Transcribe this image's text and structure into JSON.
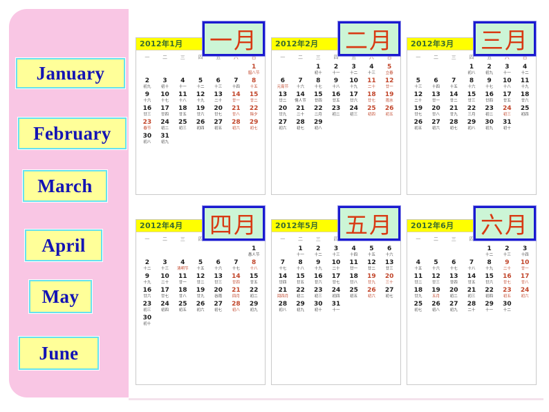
{
  "background": {
    "page_color": "#ffffff",
    "panel_color": "#f9c6e4",
    "star_glyph": "★",
    "star_glyph_2": "★"
  },
  "palette": {
    "chip_yellow": "#ffff99",
    "chip_cyan_border": "#66e2ee",
    "chip_blue_text": "#1414b4",
    "cn_chip_green": "#ccf5d6",
    "cn_chip_blue_border": "#1a1ad0",
    "cn_chip_red_text": "#d83a13",
    "cal_header_yellow": "#ffff00",
    "cal_header_text": "#3a6b2f",
    "holiday_red": "#c1452a"
  },
  "english_labels": [
    {
      "name": "january",
      "text": "January"
    },
    {
      "name": "february",
      "text": "February"
    },
    {
      "name": "march",
      "text": "March"
    },
    {
      "name": "april",
      "text": "April"
    },
    {
      "name": "may",
      "text": "May"
    },
    {
      "name": "june",
      "text": "June"
    }
  ],
  "chinese_labels": [
    {
      "name": "yi-yue",
      "text": "一月"
    },
    {
      "name": "er-yue",
      "text": "二月"
    },
    {
      "name": "san-yue",
      "text": "三月"
    },
    {
      "name": "si-yue",
      "text": "四月"
    },
    {
      "name": "wu-yue",
      "text": "五月"
    },
    {
      "name": "liu-yue",
      "text": "六月"
    }
  ],
  "weekday_headers": [
    "一",
    "二",
    "三",
    "四",
    "五",
    "六",
    "日"
  ],
  "calendars": [
    {
      "id": "jan",
      "title": "2012年1月",
      "weeks": [
        [
          null,
          null,
          null,
          null,
          null,
          null,
          {
            "n": "1",
            "s": "腊八节",
            "r": true,
            "f": true
          }
        ],
        [
          {
            "n": "2",
            "s": "初九"
          },
          {
            "n": "3",
            "s": "初十"
          },
          {
            "n": "4",
            "s": "十一"
          },
          {
            "n": "5",
            "s": "十二"
          },
          {
            "n": "6",
            "s": "十三"
          },
          {
            "n": "7",
            "s": "十四"
          },
          {
            "n": "8",
            "s": "十五",
            "r": true
          }
        ],
        [
          {
            "n": "9",
            "s": "十六"
          },
          {
            "n": "10",
            "s": "十七"
          },
          {
            "n": "11",
            "s": "十八"
          },
          {
            "n": "12",
            "s": "十九"
          },
          {
            "n": "13",
            "s": "二十"
          },
          {
            "n": "14",
            "s": "廿一",
            "r": true
          },
          {
            "n": "15",
            "s": "廿二",
            "r": true
          }
        ],
        [
          {
            "n": "16",
            "s": "廿三"
          },
          {
            "n": "17",
            "s": "廿四"
          },
          {
            "n": "18",
            "s": "廿五"
          },
          {
            "n": "19",
            "s": "廿六"
          },
          {
            "n": "20",
            "s": "廿七"
          },
          {
            "n": "21",
            "s": "廿八",
            "r": true
          },
          {
            "n": "22",
            "s": "除夕",
            "r": true
          }
        ],
        [
          {
            "n": "23",
            "s": "春节",
            "r": true,
            "f": true
          },
          {
            "n": "24",
            "s": "初二"
          },
          {
            "n": "25",
            "s": "初三"
          },
          {
            "n": "26",
            "s": "初四"
          },
          {
            "n": "27",
            "s": "初五"
          },
          {
            "n": "28",
            "s": "初六",
            "r": true
          },
          {
            "n": "29",
            "s": "初七",
            "r": true
          }
        ],
        [
          {
            "n": "30",
            "s": "初八"
          },
          {
            "n": "31",
            "s": "初九"
          },
          null,
          null,
          null,
          null,
          null
        ]
      ]
    },
    {
      "id": "feb",
      "title": "2012年2月",
      "weeks": [
        [
          null,
          null,
          {
            "n": "1",
            "s": "初十"
          },
          {
            "n": "2",
            "s": "十一"
          },
          {
            "n": "3",
            "s": "十二"
          },
          {
            "n": "4",
            "s": "十三"
          },
          {
            "n": "5",
            "s": "立春",
            "r": true
          }
        ],
        [
          {
            "n": "6",
            "s": "元宵节",
            "f": true
          },
          {
            "n": "7",
            "s": "十六"
          },
          {
            "n": "8",
            "s": "十七"
          },
          {
            "n": "9",
            "s": "十八"
          },
          {
            "n": "10",
            "s": "十九"
          },
          {
            "n": "11",
            "s": "二十",
            "r": true
          },
          {
            "n": "12",
            "s": "廿一",
            "r": true
          }
        ],
        [
          {
            "n": "13",
            "s": "廿二"
          },
          {
            "n": "14",
            "s": "情人节"
          },
          {
            "n": "15",
            "s": "廿四"
          },
          {
            "n": "16",
            "s": "廿五"
          },
          {
            "n": "17",
            "s": "廿六"
          },
          {
            "n": "18",
            "s": "廿七",
            "r": true
          },
          {
            "n": "19",
            "s": "雨水",
            "r": true
          }
        ],
        [
          {
            "n": "20",
            "s": "廿九"
          },
          {
            "n": "21",
            "s": "二十"
          },
          {
            "n": "22",
            "s": "二月"
          },
          {
            "n": "23",
            "s": "初二"
          },
          {
            "n": "24",
            "s": "初三"
          },
          {
            "n": "25",
            "s": "初四",
            "r": true
          },
          {
            "n": "26",
            "s": "初五",
            "r": true
          }
        ],
        [
          {
            "n": "27",
            "s": "初六"
          },
          {
            "n": "28",
            "s": "初七"
          },
          {
            "n": "29",
            "s": "初八"
          },
          null,
          null,
          null,
          null
        ]
      ]
    },
    {
      "id": "mar",
      "title": "2012年3月",
      "weeks": [
        [
          null,
          null,
          null,
          {
            "n": "1",
            "s": "初八"
          },
          {
            "n": "2",
            "s": "初九"
          },
          {
            "n": "3",
            "s": "十一"
          },
          {
            "n": "4",
            "s": "十二"
          }
        ],
        [
          {
            "n": "5",
            "s": "十三"
          },
          {
            "n": "6",
            "s": "十四"
          },
          {
            "n": "7",
            "s": "十五"
          },
          {
            "n": "8",
            "s": "十六"
          },
          {
            "n": "9",
            "s": "十七"
          },
          {
            "n": "10",
            "s": "十八"
          },
          {
            "n": "11",
            "s": "十九"
          }
        ],
        [
          {
            "n": "12",
            "s": "二十"
          },
          {
            "n": "13",
            "s": "廿一"
          },
          {
            "n": "14",
            "s": "廿二"
          },
          {
            "n": "15",
            "s": "廿三"
          },
          {
            "n": "16",
            "s": "廿四"
          },
          {
            "n": "17",
            "s": "廿五"
          },
          {
            "n": "18",
            "s": "廿六"
          }
        ],
        [
          {
            "n": "19",
            "s": "廿七"
          },
          {
            "n": "20",
            "s": "廿八"
          },
          {
            "n": "21",
            "s": "廿九"
          },
          {
            "n": "22",
            "s": "三月"
          },
          {
            "n": "23",
            "s": "初二"
          },
          {
            "n": "24",
            "s": "初三",
            "r": true
          },
          {
            "n": "25",
            "s": "初四"
          }
        ],
        [
          {
            "n": "26",
            "s": "初五"
          },
          {
            "n": "27",
            "s": "初六"
          },
          {
            "n": "28",
            "s": "初七"
          },
          {
            "n": "29",
            "s": "初八"
          },
          {
            "n": "30",
            "s": "初九"
          },
          {
            "n": "31",
            "s": "初十"
          },
          null
        ]
      ]
    },
    {
      "id": "apr",
      "title": "2012年4月",
      "weeks": [
        [
          null,
          null,
          null,
          null,
          null,
          null,
          {
            "n": "1",
            "s": "愚人节"
          }
        ],
        [
          {
            "n": "2",
            "s": "十二"
          },
          {
            "n": "3",
            "s": "十三"
          },
          {
            "n": "4",
            "s": "清明节",
            "f": true
          },
          {
            "n": "5",
            "s": "十五"
          },
          {
            "n": "6",
            "s": "十六"
          },
          {
            "n": "7",
            "s": "十七"
          },
          {
            "n": "8",
            "s": "十八",
            "r": true
          }
        ],
        [
          {
            "n": "9",
            "s": "十九"
          },
          {
            "n": "10",
            "s": "二十"
          },
          {
            "n": "11",
            "s": "廿一"
          },
          {
            "n": "12",
            "s": "廿二"
          },
          {
            "n": "13",
            "s": "廿三"
          },
          {
            "n": "14",
            "s": "廿四",
            "r": true
          },
          {
            "n": "15",
            "s": "廿五"
          }
        ],
        [
          {
            "n": "16",
            "s": "廿六"
          },
          {
            "n": "17",
            "s": "廿七"
          },
          {
            "n": "18",
            "s": "廿八"
          },
          {
            "n": "19",
            "s": "廿九"
          },
          {
            "n": "20",
            "s": "谷雨"
          },
          {
            "n": "21",
            "s": "四月",
            "r": true
          },
          {
            "n": "22",
            "s": "初二"
          }
        ],
        [
          {
            "n": "23",
            "s": "初三"
          },
          {
            "n": "24",
            "s": "初四"
          },
          {
            "n": "25",
            "s": "初五"
          },
          {
            "n": "26",
            "s": "初六"
          },
          {
            "n": "27",
            "s": "初七"
          },
          {
            "n": "28",
            "s": "初八",
            "r": true
          },
          {
            "n": "29",
            "s": "初九"
          }
        ],
        [
          {
            "n": "30",
            "s": "初十"
          },
          null,
          null,
          null,
          null,
          null,
          null
        ]
      ]
    },
    {
      "id": "may",
      "title": "2012年5月",
      "weeks": [
        [
          null,
          {
            "n": "1",
            "s": "十一"
          },
          {
            "n": "2",
            "s": "十二"
          },
          {
            "n": "3",
            "s": "十三"
          },
          {
            "n": "4",
            "s": "十四"
          },
          {
            "n": "5",
            "s": "十五"
          },
          {
            "n": "6",
            "s": "十六"
          }
        ],
        [
          {
            "n": "7",
            "s": "十七"
          },
          {
            "n": "8",
            "s": "十八"
          },
          {
            "n": "9",
            "s": "十九"
          },
          {
            "n": "10",
            "s": "二十"
          },
          {
            "n": "11",
            "s": "廿一"
          },
          {
            "n": "12",
            "s": "廿二"
          },
          {
            "n": "13",
            "s": "廿三"
          }
        ],
        [
          {
            "n": "14",
            "s": "廿四"
          },
          {
            "n": "15",
            "s": "廿五"
          },
          {
            "n": "16",
            "s": "廿六"
          },
          {
            "n": "17",
            "s": "廿七"
          },
          {
            "n": "18",
            "s": "廿八"
          },
          {
            "n": "19",
            "s": "廿九",
            "r": true
          },
          {
            "n": "20",
            "s": "三十",
            "r": true
          }
        ],
        [
          {
            "n": "21",
            "s": "闰四月",
            "f": true
          },
          {
            "n": "22",
            "s": "初二"
          },
          {
            "n": "23",
            "s": "初三"
          },
          {
            "n": "24",
            "s": "初四"
          },
          {
            "n": "25",
            "s": "初五"
          },
          {
            "n": "26",
            "s": "初六",
            "r": true
          },
          {
            "n": "27",
            "s": "初七"
          }
        ],
        [
          {
            "n": "28",
            "s": "初八"
          },
          {
            "n": "29",
            "s": "初九"
          },
          {
            "n": "30",
            "s": "初十"
          },
          {
            "n": "31",
            "s": "十一"
          },
          null,
          null,
          null
        ]
      ]
    },
    {
      "id": "jun",
      "title": "2012年6月",
      "weeks": [
        [
          null,
          null,
          null,
          null,
          {
            "n": "1",
            "s": "十二"
          },
          {
            "n": "2",
            "s": "十三"
          },
          {
            "n": "3",
            "s": "十四"
          }
        ],
        [
          {
            "n": "4",
            "s": "十五"
          },
          {
            "n": "5",
            "s": "十六"
          },
          {
            "n": "6",
            "s": "十七"
          },
          {
            "n": "7",
            "s": "十八"
          },
          {
            "n": "8",
            "s": "十九"
          },
          {
            "n": "9",
            "s": "二十",
            "r": true
          },
          {
            "n": "10",
            "s": "廿一",
            "r": true
          }
        ],
        [
          {
            "n": "11",
            "s": "廿二"
          },
          {
            "n": "12",
            "s": "廿三"
          },
          {
            "n": "13",
            "s": "廿四"
          },
          {
            "n": "14",
            "s": "廿五"
          },
          {
            "n": "15",
            "s": "廿六"
          },
          {
            "n": "16",
            "s": "廿七",
            "r": true
          },
          {
            "n": "17",
            "s": "廿八",
            "r": true
          }
        ],
        [
          {
            "n": "18",
            "s": "廿九"
          },
          {
            "n": "19",
            "s": "五月",
            "f": true
          },
          {
            "n": "20",
            "s": "初二"
          },
          {
            "n": "21",
            "s": "初三"
          },
          {
            "n": "22",
            "s": "初四"
          },
          {
            "n": "23",
            "s": "初五",
            "r": true
          },
          {
            "n": "24",
            "s": "初六",
            "r": true
          }
        ],
        [
          {
            "n": "25",
            "s": "初七"
          },
          {
            "n": "26",
            "s": "初八"
          },
          {
            "n": "27",
            "s": "初九"
          },
          {
            "n": "28",
            "s": "二十"
          },
          {
            "n": "29",
            "s": "十一"
          },
          {
            "n": "30",
            "s": "十二"
          },
          null
        ]
      ]
    }
  ]
}
